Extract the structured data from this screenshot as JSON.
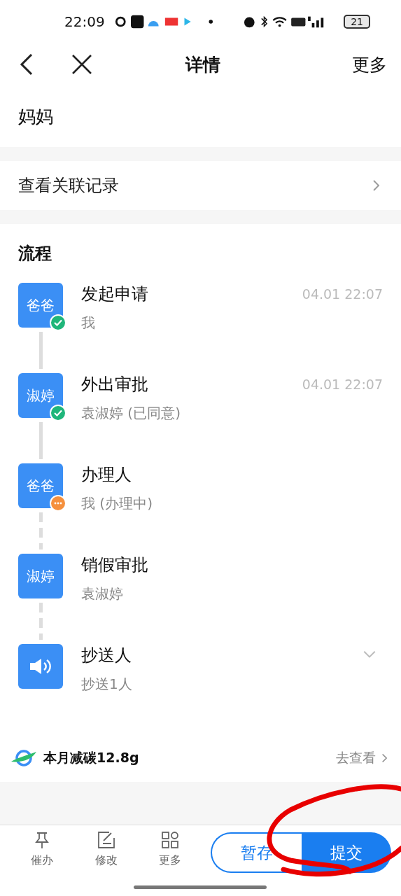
{
  "status_bar": {
    "time": "22:09",
    "battery": "21"
  },
  "header": {
    "title": "详情",
    "more": "更多"
  },
  "field": {
    "value": "妈妈"
  },
  "related": {
    "label": "查看关联记录"
  },
  "flow": {
    "title": "流程",
    "steps": [
      {
        "kind": "person",
        "avatar": "爸爸",
        "done": true,
        "in_progress": false,
        "title": "发起申请",
        "subtitle": "我",
        "time": "04.01 22:07",
        "expandable": false
      },
      {
        "kind": "person",
        "avatar": "淑婷",
        "done": true,
        "in_progress": false,
        "title": "外出审批",
        "subtitle": "袁淑婷 (已同意)",
        "time": "04.01 22:07",
        "expandable": false
      },
      {
        "kind": "person",
        "avatar": "爸爸",
        "done": false,
        "in_progress": true,
        "title": "办理人",
        "subtitle": "我 (办理中)",
        "expandable": false
      },
      {
        "kind": "person",
        "avatar": "淑婷",
        "done": false,
        "in_progress": false,
        "title": "销假审批",
        "subtitle": "袁淑婷",
        "expandable": false
      },
      {
        "kind": "cc",
        "done": false,
        "in_progress": false,
        "title": "抄送人",
        "subtitle": "抄送1人",
        "expandable": true
      }
    ]
  },
  "carbon": {
    "label": "本月减碳12.8g",
    "link": "去查看"
  },
  "toolbar": {
    "actions": [
      {
        "kind": "pin",
        "label": "催办"
      },
      {
        "kind": "edit",
        "label": "修改"
      },
      {
        "kind": "grid",
        "label": "更多"
      }
    ],
    "save": "暂存",
    "submit": "提交"
  },
  "annotation": {
    "kind": "circle"
  }
}
